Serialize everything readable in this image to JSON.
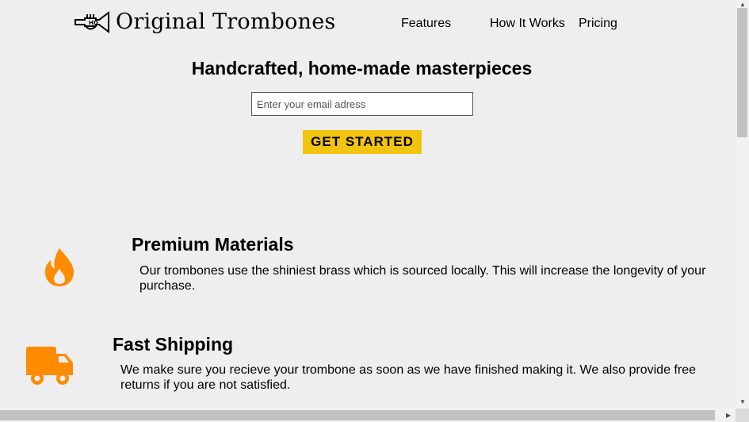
{
  "header": {
    "logo_icon": "trumpet-icon",
    "logo_text": "Original Trombones",
    "nav": [
      "Features",
      "How It Works",
      "Pricing"
    ]
  },
  "hero": {
    "title": "Handcrafted, home-made masterpieces",
    "email_placeholder": "Enter your email adress",
    "cta_label": "GET STARTED"
  },
  "features": [
    {
      "icon": "fire-icon",
      "title": "Premium Materials",
      "description": "Our trombones use the shiniest brass which is sourced locally. This will increase the longevity of your purchase."
    },
    {
      "icon": "truck-icon",
      "title": "Fast Shipping",
      "description": "We make sure you recieve your trombone as soon as we have finished making it. We also provide free returns if you are not satisfied."
    }
  ],
  "colors": {
    "background": "#eeeeee",
    "accent": "#f1c40f",
    "icon": "#ff8c00"
  }
}
